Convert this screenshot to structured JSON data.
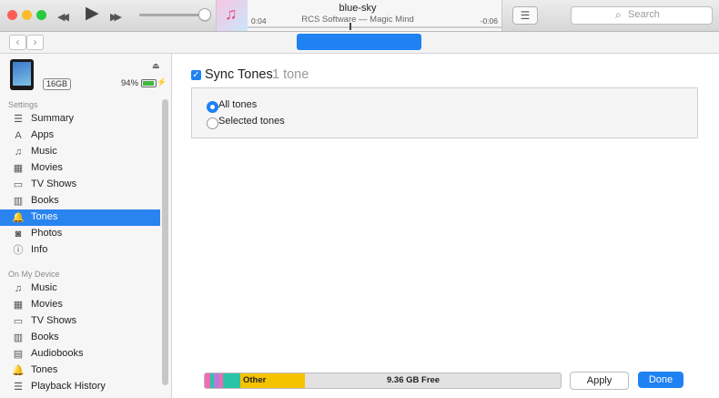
{
  "now_playing": {
    "title": "blue-sky",
    "subtitle": "RCS Software — Magic Mind",
    "elapsed": "0:04",
    "remaining": "-0:06",
    "progress": 0.4
  },
  "transport": {
    "back_icon": "◀◀",
    "play_icon": "▶",
    "forward_icon": "▶▶",
    "volume": 0.9
  },
  "toolbar": {
    "list_icon": "☰",
    "search_placeholder": "Search",
    "search_icon": "⌕"
  },
  "nav": {
    "back": "‹",
    "forward": "›"
  },
  "device": {
    "capacity": "16GB",
    "battery": "94%",
    "battery_level": 0.94,
    "eject_icon": "⏏",
    "bolt_icon": "⚡"
  },
  "sidebar": {
    "settings_label": "Settings",
    "settings_items": [
      {
        "label": "Summary",
        "icon": "☰"
      },
      {
        "label": "Apps",
        "icon": "A"
      },
      {
        "label": "Music",
        "icon": "♫"
      },
      {
        "label": "Movies",
        "icon": "▦"
      },
      {
        "label": "TV Shows",
        "icon": "▭"
      },
      {
        "label": "Books",
        "icon": "▥"
      },
      {
        "label": "Tones",
        "icon": "🔔"
      },
      {
        "label": "Photos",
        "icon": "◙"
      },
      {
        "label": "Info",
        "icon": "ⓘ"
      }
    ],
    "selected": "Tones",
    "device_label": "On My Device",
    "device_items": [
      {
        "label": "Music",
        "icon": "♫"
      },
      {
        "label": "Movies",
        "icon": "▦"
      },
      {
        "label": "TV Shows",
        "icon": "▭"
      },
      {
        "label": "Books",
        "icon": "▥"
      },
      {
        "label": "Audiobooks",
        "icon": "▤"
      },
      {
        "label": "Tones",
        "icon": "🔔"
      },
      {
        "label": "Playback History",
        "icon": "☰"
      }
    ]
  },
  "main": {
    "sync_label": "Sync Tones",
    "sync_count": "1 tone",
    "sync_checked": true,
    "options": [
      {
        "label": "All tones",
        "selected": true
      },
      {
        "label": "Selected tones",
        "selected": false
      }
    ]
  },
  "storage": {
    "other_label": "Other",
    "free_label": "9.36 GB Free",
    "colors": {
      "audio": "#ef6bb3",
      "photos": "#b37ddb",
      "apps": "#29c4a6",
      "other": "#f5c300",
      "free": "#e2e2e2"
    }
  },
  "footer": {
    "apply": "Apply",
    "done": "Done"
  },
  "colors": {
    "accent": "#1f82f3",
    "selection": "#2a84ef"
  }
}
